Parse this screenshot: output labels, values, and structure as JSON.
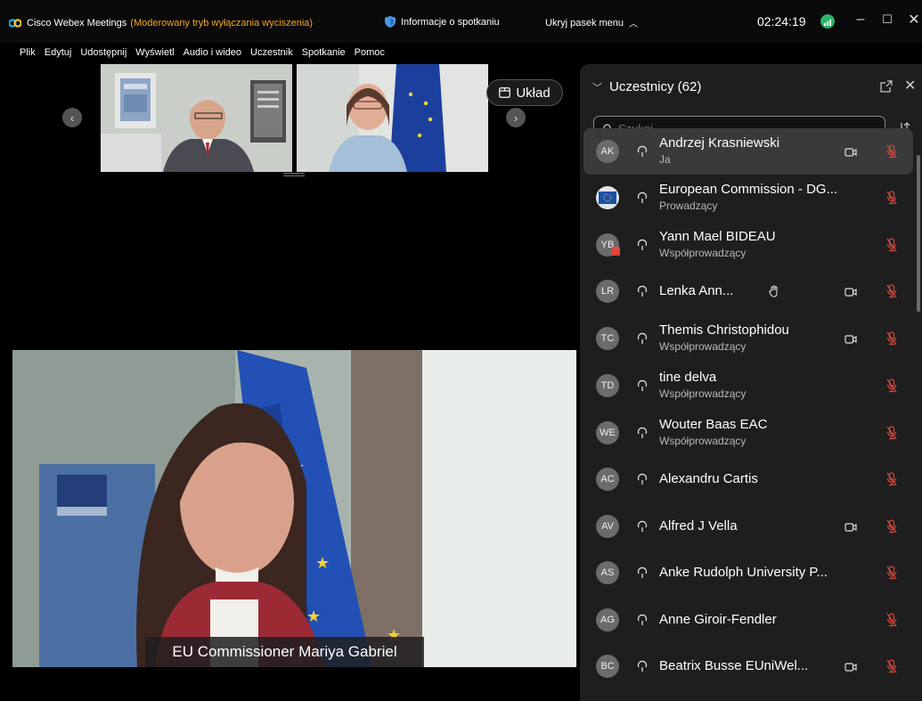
{
  "window": {
    "app_name": "Cisco Webex Meetings",
    "mode_text": "(Moderowany tryb wyłączania wyciszenia)",
    "meeting_info": "Informacje o spotkaniu",
    "hide_menu": "Ukryj pasek menu",
    "clock": "02:24:19",
    "minimize": "–",
    "maximize": "☐",
    "close": "✕"
  },
  "menu": [
    "Plik",
    "Edytuj",
    "Udostępnij",
    "Wyświetl",
    "Audio i wideo",
    "Uczestnik",
    "Spotkanie",
    "Pomoc"
  ],
  "video": {
    "layout_label": "Układ",
    "prev_arrow": "‹",
    "next_arrow": "›",
    "active_speaker": "EU Commissioner Mariya Gabriel"
  },
  "panel": {
    "title": "Uczestnicy (62)",
    "search_placeholder": "Szukaj",
    "close": "✕"
  },
  "participants": [
    {
      "initials": "AK",
      "name": "Andrzej Krasniewski",
      "role": "Ja",
      "camera": true
    },
    {
      "initials": "",
      "name": "European Commission - DG...",
      "role": "Prowadzący",
      "camera": false
    },
    {
      "initials": "YB",
      "name": "Yann Mael BIDEAU",
      "role": "Współprowadzący",
      "camera": false
    },
    {
      "initials": "LR",
      "name": "Lenka Ann...",
      "role": "",
      "camera": true,
      "hand": true
    },
    {
      "initials": "TC",
      "name": "Themis Christophidou",
      "role": "Współprowadzący",
      "camera": true
    },
    {
      "initials": "TD",
      "name": "tine delva",
      "role": "Współprowadzący",
      "camera": false
    },
    {
      "initials": "WE",
      "name": "Wouter Baas EAC",
      "role": "Współprowadzący",
      "camera": false
    },
    {
      "initials": "AC",
      "name": "Alexandru Cartis",
      "role": "",
      "camera": false
    },
    {
      "initials": "AV",
      "name": "Alfred J Vella",
      "role": "",
      "camera": true
    },
    {
      "initials": "AS",
      "name": "Anke Rudolph University P...",
      "role": "",
      "camera": false
    },
    {
      "initials": "AG",
      "name": "Anne Giroir-Fendler",
      "role": "",
      "camera": false
    },
    {
      "initials": "BC",
      "name": "Beatrix Busse EUniWel...",
      "role": "",
      "camera": true
    }
  ],
  "colors": {
    "mode_orange": "#f5a623",
    "signal_green": "#2fb36a",
    "muted_red": "#e0463a",
    "panel_bg": "#1e1e1e"
  }
}
